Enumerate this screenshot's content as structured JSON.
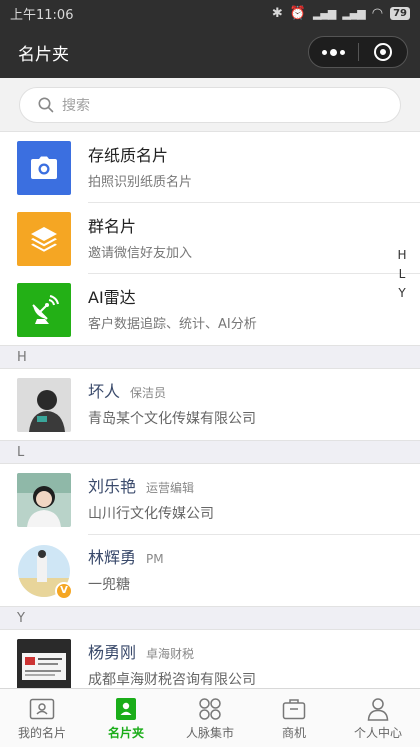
{
  "status": {
    "time": "上午11:06",
    "battery": "79"
  },
  "nav": {
    "title": "名片夹"
  },
  "search": {
    "placeholder": "搜索"
  },
  "features": [
    {
      "title": "存纸质名片",
      "subtitle": "拍照识别纸质名片",
      "color": "#3b6fe0",
      "icon": "camera-icon"
    },
    {
      "title": "群名片",
      "subtitle": "邀请微信好友加入",
      "color": "#f5a623",
      "icon": "layers-icon"
    },
    {
      "title": "AI雷达",
      "subtitle": "客户数据追踪、统计、AI分析",
      "color": "#23b016",
      "icon": "radar-dish-icon"
    }
  ],
  "index_letters": [
    "H",
    "L",
    "Y"
  ],
  "sections": [
    {
      "letter": "H",
      "contacts": [
        {
          "name": "坏人",
          "role": "保洁员",
          "company": "青岛某个文化传媒有限公司"
        }
      ]
    },
    {
      "letter": "L",
      "contacts": [
        {
          "name": "刘乐艳",
          "role": "运营编辑",
          "company": "山川行文化传媒公司"
        },
        {
          "name": "林辉勇",
          "role": "PM",
          "company": "一兜糖"
        }
      ]
    },
    {
      "letter": "Y",
      "contacts": [
        {
          "name": "杨勇刚",
          "role": "卓海财税",
          "company": "成都卓海财税咨询有限公司"
        }
      ]
    }
  ],
  "tabs": [
    {
      "label": "我的名片",
      "icon": "id-card-icon",
      "active": false
    },
    {
      "label": "名片夹",
      "icon": "contacts-book-icon",
      "active": true
    },
    {
      "label": "人脉集市",
      "icon": "grid-circles-icon",
      "active": false
    },
    {
      "label": "商机",
      "icon": "briefcase-icon",
      "active": false
    },
    {
      "label": "个人中心",
      "icon": "person-icon",
      "active": false
    }
  ]
}
